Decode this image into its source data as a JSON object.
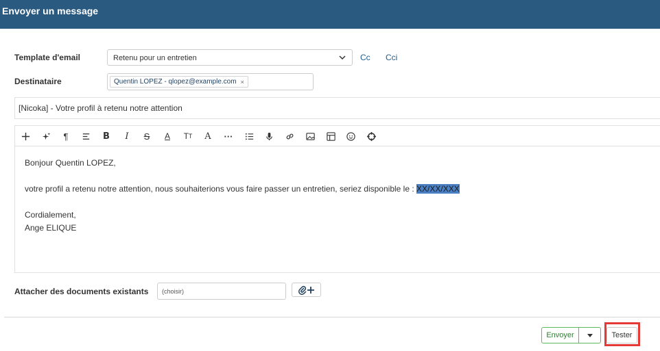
{
  "header": {
    "title": "Envoyer un message"
  },
  "form": {
    "template_label": "Template d'email",
    "template_value": "Retenu pour un entretien",
    "cc_label": "Cc",
    "cci_label": "Cci",
    "recipient_label": "Destinataire",
    "recipient_tag": "Quentin LOPEZ - qlopez@example.com",
    "recipient_remove": "×",
    "subject": "[Nicoka] - Votre profil à retenu notre attention"
  },
  "editor": {
    "toolbar_icons": [
      "plus-icon",
      "magic-icon",
      "paragraph-icon",
      "align-icon",
      "bold-icon",
      "italic-icon",
      "strikethrough-icon",
      "text-color-icon",
      "text-size-icon",
      "font-icon",
      "more-icon",
      "list-icon",
      "microphone-icon",
      "link-icon",
      "image-icon",
      "table-icon",
      "emoji-icon",
      "target-icon"
    ],
    "greeting": "Bonjour Quentin LOPEZ,",
    "body_text": "votre profil a retenu notre attention, nous souhaiterions vous faire passer un entretien, seriez disponible le : ",
    "highlight": "XX/XX/XXX",
    "closing": "Cordialement,",
    "signature": "Ange ELIQUE"
  },
  "attach": {
    "label": "Attacher des documents existants",
    "placeholder": "(choisir)"
  },
  "footer": {
    "send_label": "Envoyer",
    "test_label": "Tester"
  },
  "colors": {
    "header": "#2a5a80",
    "send_border": "#5cb85c",
    "highlight": "#4a7fc3",
    "focus_box": "#e53935"
  }
}
